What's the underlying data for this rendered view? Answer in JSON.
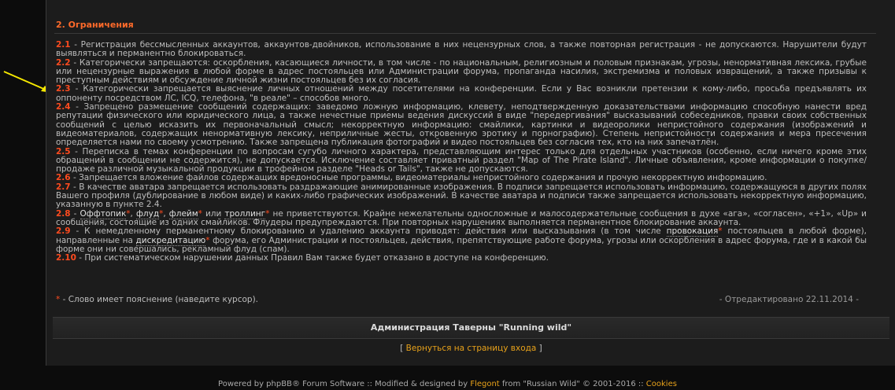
{
  "section": {
    "title": "2. Ограничения"
  },
  "rules": [
    {
      "num": "2.1",
      "text": " - Регистрация бессмысленных аккаунтов, аккаунтов-двойников, использование в них нецензурных слов, а также повторная регистрация - не допускаются. Нарушители будут выявляться и перманентно блокироваться."
    },
    {
      "num": "2.2",
      "text": " - Категорически запрещаются: оскорбления, касающиеся личности, в том числе - по национальным, религиозным и половым признакам, угрозы, ненормативная лексика, грубые или нецензурные выражения в любой форме в адрес постояльцев или Администрации форума, пропаганда насилия, экстремизма и половых извращений, а также призывы к преступным действиям и обсуждение личной жизни постояльцев без их согласия."
    },
    {
      "num": "2.3",
      "text": " - Категорически запрещается выяснение личных отношений между посетителями на конференции. Если у Вас возникли претензии к кому-либо, просьба предъявлять их оппоненту посредством ЛС, ICQ, телефона, \"в реале\" – способов много."
    },
    {
      "num": "2.4",
      "text": " - Запрещено размещение сообщений содержащих: заведомо ложную информацию, клевету, неподтвержденную доказательствами информацию способную нанести вред репутации физического или юридического лица, а также нечестные приемы ведения дискуссий в виде \"передергивания\" высказываний собеседников, правки своих собственных сообщений с целью исказить их первоначальный смысл; некорректную информацию: смайлики, картинки и видеоролики непристойного содержания (изображений и видеоматериалов, содержащих ненормативную лексику, неприличные жесты, откровенную эротику и порнографию). Степень непристойности содержания и мера пресечения определяется нами по своему усмотрению. Также запрещена публикация фотографий и видео постояльцев без согласия тех, кто на них запечатлён."
    },
    {
      "num": "2.5",
      "text": " - Переписка в темах конференции по вопросам сугубо личного характера, представляющим интерес только для отдельных участников (особенно, если ничего кроме этих обращений в сообщении не содержится), не допускается. Исключение составляет приватный раздел \"Map of The Pirate Island\". Личные объявления, кроме информации о покупке/продаже различной музыкальной продукции в трофейном разделе \"Heads or Tails\", также не допускаются."
    },
    {
      "num": "2.6",
      "text": " - Запрещается вложение файлов содержащих вредоносные программы, видеоматериалы непристойного содержания и прочую некорректную информацию."
    },
    {
      "num": "2.7",
      "text": " - В качестве аватара запрещается использовать раздражающие анимированные изображения. В подписи запрещается использовать информацию, содержащуюся в других полях Вашего профиля (дублирование в любом виде) и каких-либо графических изображений. В качестве аватара и подписи также запрещается использовать некорректную информацию, указанную в пункте 2.4."
    }
  ],
  "rule28": {
    "num": "2.8",
    "t0": " - ",
    "h1": "Оффтопик",
    "s1": ", ",
    "h2": "флуд",
    "s2": ", ",
    "h3": "флейм",
    "s3": " или ",
    "h4": "троллинг",
    "rest": " не приветствуются. Крайне нежелательны односложные и малосодержательные сообщения в духе «ага», «согласен», «+1», «Up» и сообщения, состоящие из одних смайликов. Флудеры предупреждаются. При повторных нарушениях выполняется перманентное блокирование аккаунта."
  },
  "rule29": {
    "num": "2.9",
    "t0": " - К немедленному перманентному блокированию и удалению аккаунта приводят: действия или высказывания (в том числе ",
    "h1": "провокация",
    "t1": " постояльцев в любой форме), направленные на ",
    "h2": "дискредитацию",
    "t2": " форума, его Администрации и постояльцев, действия, препятствующие работе форума, угрозы или оскорбления в адрес форума, где и в какой бы форме они ни совершались, рекламный флуд (спам)."
  },
  "rule210": {
    "num": "2.10",
    "text": " - При систематическом нарушении данных Правил Вам также будет отказано в доступе на конференцию."
  },
  "asterisk": "*",
  "footnote": {
    "text": " - Слово имеет пояснение (наведите курсор).",
    "edited": "- Отредактировано 22.11.2014 -"
  },
  "signature": "Администрация Таверны \"Running wild\"",
  "back": {
    "open": "[ ",
    "link": "Вернуться на страницу входа",
    "close": " ]"
  },
  "footer": {
    "t1": "Powered by phpBB® Forum Software :: Modified & designed by ",
    "link1": "Flegont",
    "t2": " from \"Russian Wild\" © 2001-2016 :: ",
    "link2": "Cookies"
  },
  "colors": {
    "accent": "#ff4b1f",
    "link": "#e8a21a",
    "arrow": "#f5e800"
  }
}
